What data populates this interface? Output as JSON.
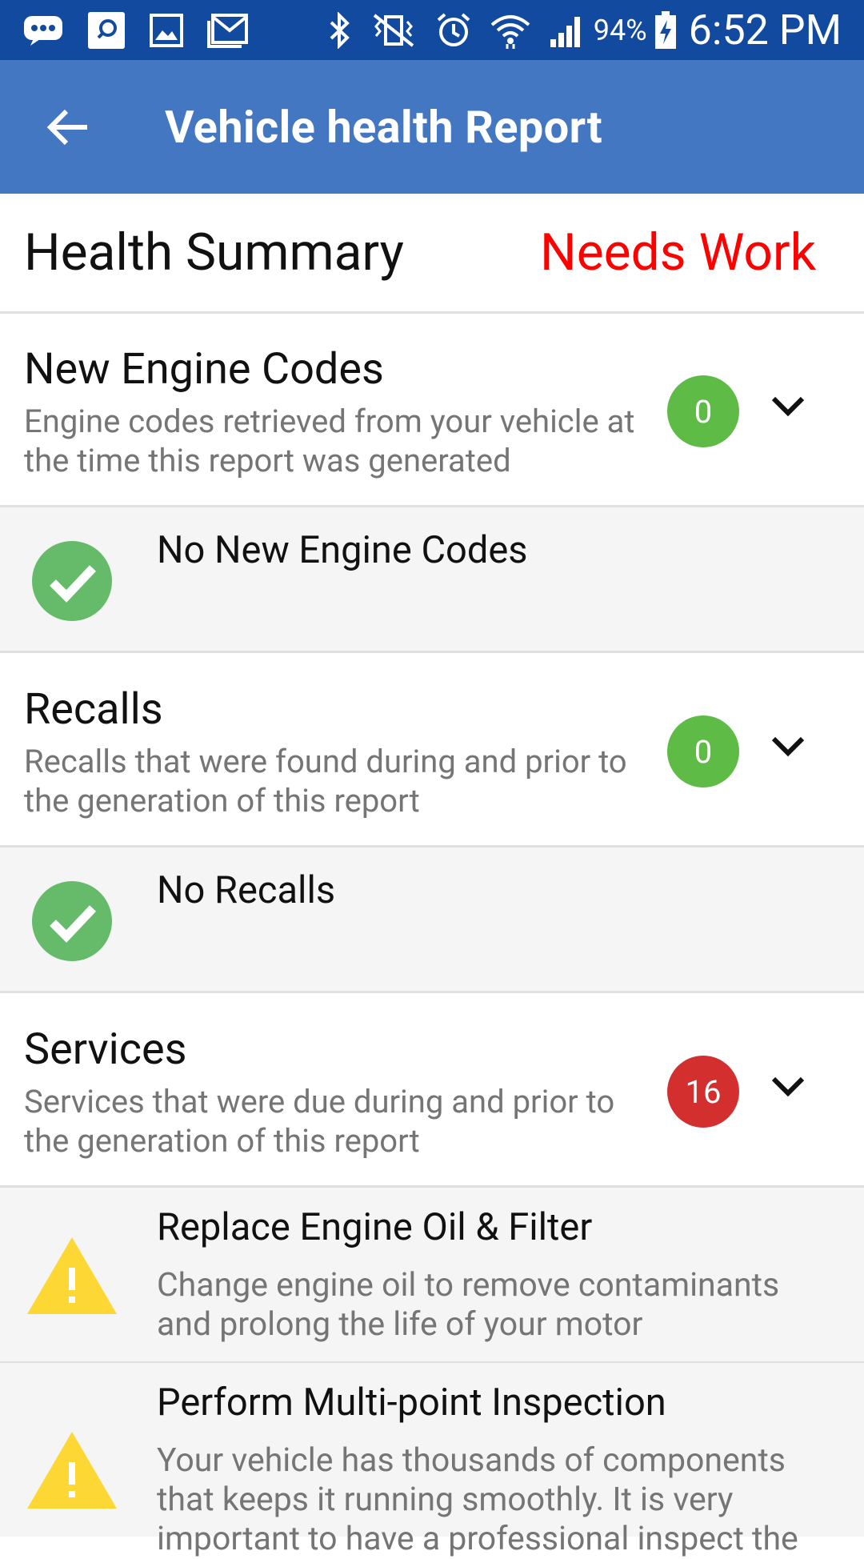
{
  "status_bar": {
    "battery": "94%",
    "time": "6:52 PM",
    "icons": [
      "message-icon",
      "app-icon",
      "gallery-icon",
      "email-icon",
      "bluetooth-icon",
      "vibrate-icon",
      "alarm-icon",
      "wifi-icon",
      "signal-icon",
      "battery-charging-icon"
    ]
  },
  "app_bar": {
    "back_icon": "arrow-back-icon",
    "title": "Vehicle health Report",
    "color": "#4377c2"
  },
  "summary": {
    "title": "Health Summary",
    "status": "Needs Work",
    "status_color": "#ff0000"
  },
  "sections": [
    {
      "title": "New Engine Codes",
      "description": "Engine codes retrieved from your vehicle at the time this report was generated",
      "count": "0",
      "badge_color": "#5dbb46",
      "items": [
        {
          "type": "ok",
          "icon": "check-circle-icon",
          "text": "No New Engine Codes"
        }
      ]
    },
    {
      "title": "Recalls",
      "description": "Recalls that were found during and prior to the generation of this report",
      "count": "0",
      "badge_color": "#5dbb46",
      "items": [
        {
          "type": "ok",
          "icon": "check-circle-icon",
          "text": "No Recalls"
        }
      ]
    },
    {
      "title": "Services",
      "description": "Services that were due during and prior to the generation of this report",
      "count": "16",
      "badge_color": "#d32f2f",
      "items": [
        {
          "type": "warning",
          "icon": "warning-triangle-icon",
          "title": "Replace Engine Oil & Filter",
          "description": "Change engine oil to remove contaminants and prolong the life of your motor"
        },
        {
          "type": "warning",
          "icon": "warning-triangle-icon",
          "title": "Perform Multi-point Inspection",
          "description": "Your vehicle has thousands of components that keeps it running smoothly. It is very important to have a professional inspect the"
        }
      ]
    }
  ],
  "colors": {
    "status_bar": "#114a9e",
    "ok_green": "#66bb6a",
    "warning_yellow": "#fdd835"
  }
}
